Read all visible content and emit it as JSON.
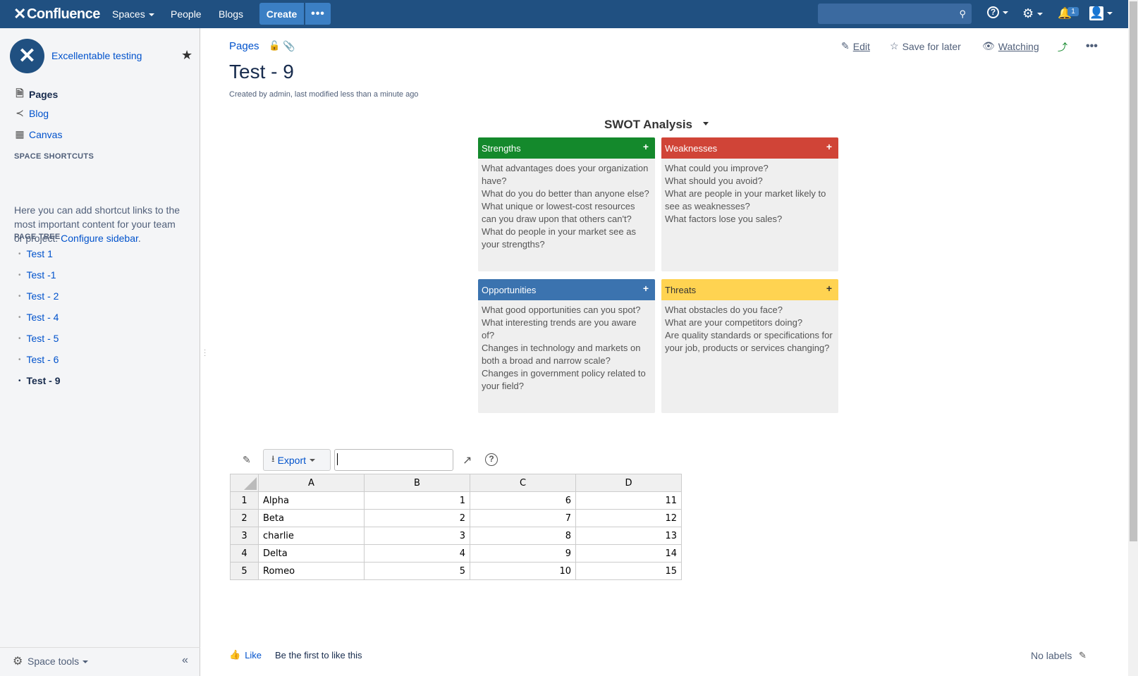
{
  "header": {
    "logo": "Confluence",
    "nav": {
      "spaces": "Spaces",
      "people": "People",
      "blogs": "Blogs"
    },
    "create": "Create",
    "more": "•••",
    "notifications_count": "1"
  },
  "sidebar": {
    "space_name": "Excellentable testing",
    "nav": {
      "pages": "Pages",
      "blog": "Blog",
      "canvas": "Canvas"
    },
    "shortcuts_header": "SPACE SHORTCUTS",
    "shortcuts_text": "Here you can add shortcut links to the most important content for your team or project.",
    "configure_link": "Configure sidebar",
    "page_tree_header": "PAGE TREE",
    "tree": [
      "Test 1",
      "Test -1",
      "Test - 2",
      "Test - 4",
      "Test - 5",
      "Test - 6",
      "Test - 9"
    ],
    "space_tools": "Space tools"
  },
  "page": {
    "breadcrumb": "Pages",
    "actions": {
      "edit": "Edit",
      "save": "Save for later",
      "watching": "Watching"
    },
    "title": "Test - 9",
    "meta": "Created by admin, last modified less than a minute ago"
  },
  "swot": {
    "title": "SWOT Analysis",
    "strengths": {
      "label": "Strengths",
      "text": "What advantages does your organization have?\nWhat do you do better than anyone else?\nWhat unique or lowest-cost resources can you draw upon that others can't?\nWhat do people in your market see as your strengths?"
    },
    "weaknesses": {
      "label": "Weaknesses",
      "text": "What could you improve?\nWhat should you avoid?\nWhat are people in your market likely to see as weaknesses?\nWhat factors lose you sales?"
    },
    "opportunities": {
      "label": "Opportunities",
      "text": "What good opportunities can you spot?\nWhat interesting trends are you aware of?\nChanges in technology and markets on both a broad and narrow scale?\nChanges in government policy related to your field?"
    },
    "threats": {
      "label": "Threats",
      "text": "What obstacles do you face?\nWhat are your competitors doing?\nAre quality standards or specifications for your job, products or services changing?"
    }
  },
  "spreadsheet": {
    "export": "Export",
    "columns": [
      "A",
      "B",
      "C",
      "D"
    ],
    "rows": [
      [
        "1",
        "Alpha",
        "1",
        "6",
        "11"
      ],
      [
        "2",
        "Beta",
        "2",
        "7",
        "12"
      ],
      [
        "3",
        "charlie",
        "3",
        "8",
        "13"
      ],
      [
        "4",
        "Delta",
        "4",
        "9",
        "14"
      ],
      [
        "5",
        "Romeo",
        "5",
        "10",
        "15"
      ]
    ]
  },
  "footer": {
    "like": "Like",
    "like_text": "Be the first to like this",
    "labels": "No labels"
  }
}
